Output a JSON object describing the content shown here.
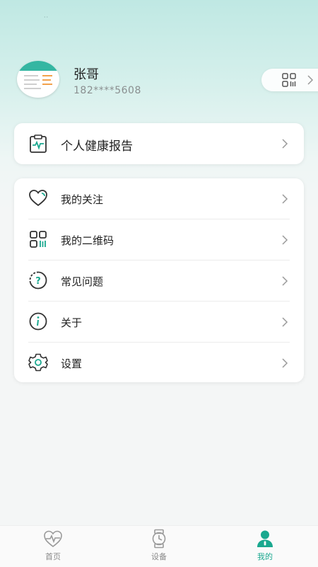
{
  "user": {
    "name": "张哥",
    "phone": "182****5608"
  },
  "report": {
    "label": "个人健康报告",
    "icon": "health-report-icon"
  },
  "menu": {
    "items": [
      {
        "label": "我的关注",
        "icon": "heart-icon"
      },
      {
        "label": "我的二维码",
        "icon": "qr-code-icon"
      },
      {
        "label": "常见问题",
        "icon": "question-icon"
      },
      {
        "label": "关于",
        "icon": "info-icon"
      },
      {
        "label": "设置",
        "icon": "gear-icon"
      }
    ]
  },
  "tabbar": {
    "tabs": [
      {
        "label": "首页",
        "icon": "heartbeat-icon"
      },
      {
        "label": "设备",
        "icon": "watch-icon"
      },
      {
        "label": "我的",
        "icon": "person-icon"
      }
    ],
    "active_index": 2
  },
  "colors": {
    "accent": "#1aa88f",
    "header_gradient_top": "#bfe8e3"
  }
}
